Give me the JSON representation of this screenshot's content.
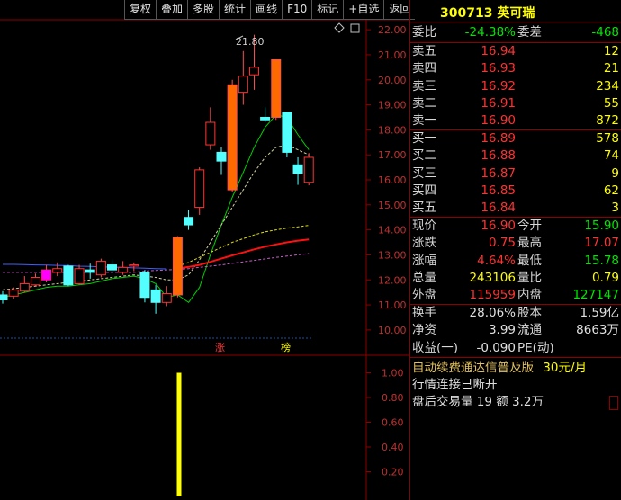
{
  "toolbar": [
    "复权",
    "叠加",
    "多股",
    "统计",
    "画线",
    "F10",
    "标记",
    "+自选",
    "返回"
  ],
  "stock": {
    "code": "300713",
    "name": "英可瑞"
  },
  "weibi": {
    "label1": "委比",
    "value1": "-24.38%",
    "label2": "委差",
    "value2": "-468"
  },
  "sell_orders": [
    {
      "label": "卖五",
      "price": "16.94",
      "volume": "12"
    },
    {
      "label": "卖四",
      "price": "16.93",
      "volume": "21"
    },
    {
      "label": "卖三",
      "price": "16.92",
      "volume": "234"
    },
    {
      "label": "卖二",
      "price": "16.91",
      "volume": "55"
    },
    {
      "label": "卖一",
      "price": "16.90",
      "volume": "872"
    }
  ],
  "buy_orders": [
    {
      "label": "买一",
      "price": "16.89",
      "volume": "578"
    },
    {
      "label": "买二",
      "price": "16.88",
      "volume": "74"
    },
    {
      "label": "买三",
      "price": "16.87",
      "volume": "9"
    },
    {
      "label": "买四",
      "price": "16.85",
      "volume": "62"
    },
    {
      "label": "买五",
      "price": "16.84",
      "volume": "3"
    }
  ],
  "stats_a": [
    {
      "l1": "现价",
      "v1": "16.90",
      "c1": "red",
      "l2": "今开",
      "v2": "15.90",
      "c2": "green"
    },
    {
      "l1": "涨跌",
      "v1": "0.75",
      "c1": "red",
      "l2": "最高",
      "v2": "17.07",
      "c2": "red"
    },
    {
      "l1": "涨幅",
      "v1": "4.64%",
      "c1": "red",
      "l2": "最低",
      "v2": "15.78",
      "c2": "green"
    },
    {
      "l1": "总量",
      "v1": "243106",
      "c1": "yellow",
      "l2": "量比",
      "v2": "0.79",
      "c2": "yellow"
    },
    {
      "l1": "外盘",
      "v1": "115959",
      "c1": "red",
      "l2": "内盘",
      "v2": "127147",
      "c2": "green"
    }
  ],
  "stats_b": [
    {
      "l1": "换手",
      "v1": "28.06%",
      "c1": "white",
      "l2": "股本",
      "v2": "1.59亿",
      "c2": "white"
    },
    {
      "l1": "净资",
      "v1": "3.99",
      "c1": "white",
      "l2": "流通",
      "v2": "8663万",
      "c2": "white"
    },
    {
      "l1": "收益(一)",
      "v1": "-0.090",
      "c1": "white",
      "l2": "PE(动)",
      "v2": "",
      "c2": "white"
    }
  ],
  "info": {
    "promo": "自动续费通达信普及版",
    "promo_price": "30元/月",
    "status": "行情连接已断开",
    "after_hours": "盘后交易量 19 额 3.2万"
  },
  "markers": [
    "涨",
    "榜"
  ],
  "high_label": "21.80",
  "chart_data": {
    "type": "candlestick",
    "price_axis": {
      "ticks": [
        10.0,
        11.0,
        12.0,
        13.0,
        14.0,
        15.0,
        16.0,
        17.0,
        18.0,
        19.0,
        20.0,
        21.0,
        22.0
      ],
      "range": [
        9.6,
        22.4
      ]
    },
    "volume_axis": {
      "ticks": [
        0.2,
        0.4,
        0.6,
        0.8,
        1.0
      ],
      "range": [
        0,
        1.12
      ]
    },
    "candles": [
      {
        "o": 11.4,
        "c": 11.2,
        "h": 11.55,
        "l": 11.05
      },
      {
        "o": 11.35,
        "c": 11.6,
        "h": 11.7,
        "l": 11.25
      },
      {
        "o": 11.55,
        "c": 11.85,
        "h": 12.15,
        "l": 11.5
      },
      {
        "o": 11.8,
        "c": 12.1,
        "h": 12.25,
        "l": 11.75
      },
      {
        "o": 12.0,
        "c": 12.4,
        "h": 12.6,
        "l": 11.9
      },
      {
        "o": 12.3,
        "c": 12.45,
        "h": 12.7,
        "l": 12.15
      },
      {
        "o": 12.55,
        "c": 11.8,
        "h": 12.6,
        "l": 11.75
      },
      {
        "o": 11.85,
        "c": 12.45,
        "h": 12.6,
        "l": 11.8
      },
      {
        "o": 12.4,
        "c": 12.3,
        "h": 12.65,
        "l": 12.05
      },
      {
        "o": 12.2,
        "c": 12.75,
        "h": 12.85,
        "l": 12.1
      },
      {
        "o": 12.6,
        "c": 12.4,
        "h": 12.8,
        "l": 12.3
      },
      {
        "o": 12.3,
        "c": 12.5,
        "h": 12.75,
        "l": 12.2
      },
      {
        "o": 12.55,
        "c": 12.6,
        "h": 12.7,
        "l": 12.35
      },
      {
        "o": 12.3,
        "c": 11.3,
        "h": 12.4,
        "l": 11.1
      },
      {
        "o": 11.6,
        "c": 11.1,
        "h": 11.8,
        "l": 10.65
      },
      {
        "o": 11.1,
        "c": 11.45,
        "h": 11.75,
        "l": 10.95
      },
      {
        "o": 11.4,
        "c": 13.7,
        "h": 13.75,
        "l": 11.3
      },
      {
        "o": 14.5,
        "c": 14.2,
        "h": 14.8,
        "l": 14.0
      },
      {
        "o": 14.9,
        "c": 16.4,
        "h": 16.5,
        "l": 14.6
      },
      {
        "o": 17.4,
        "c": 18.3,
        "h": 18.9,
        "l": 17.2
      },
      {
        "o": 17.1,
        "c": 16.75,
        "h": 17.3,
        "l": 16.2
      },
      {
        "o": 15.6,
        "c": 19.8,
        "h": 20.0,
        "l": 15.5
      },
      {
        "o": 19.5,
        "c": 20.15,
        "h": 21.15,
        "l": 19.0
      },
      {
        "o": 20.2,
        "c": 20.5,
        "h": 21.8,
        "l": 19.6
      },
      {
        "o": 18.5,
        "c": 18.4,
        "h": 18.9,
        "l": 18.3
      },
      {
        "o": 18.5,
        "c": 20.8,
        "h": 20.8,
        "l": 18.4
      },
      {
        "o": 18.7,
        "c": 17.1,
        "h": 18.7,
        "l": 16.9
      },
      {
        "o": 16.6,
        "c": 16.25,
        "h": 16.9,
        "l": 15.8
      },
      {
        "o": 15.9,
        "c": 16.9,
        "h": 17.07,
        "l": 15.78
      }
    ],
    "ma_lines": [
      {
        "color": "#00d000",
        "dash": false,
        "values": [
          11.3,
          11.4,
          11.5,
          11.6,
          11.7,
          11.75,
          11.75,
          11.8,
          11.85,
          11.95,
          12.05,
          12.1,
          12.15,
          12.05,
          11.85,
          11.3,
          11.4,
          11.1,
          11.7,
          13.0,
          14.2,
          15.3,
          16.3,
          17.3,
          18.1,
          18.6,
          18.5,
          17.8,
          17.2
        ]
      },
      {
        "color": "#d0d0a0",
        "dash": true,
        "values": [
          11.6,
          11.65,
          11.7,
          11.75,
          11.8,
          11.85,
          11.9,
          11.95,
          12.0,
          12.05,
          12.1,
          12.15,
          12.2,
          12.15,
          12.1,
          12.0,
          12.0,
          12.2,
          12.8,
          13.5,
          14.2,
          14.9,
          15.6,
          16.3,
          16.9,
          17.3,
          17.4,
          17.2,
          17.0
        ]
      },
      {
        "color": "#ff1010",
        "dash": false,
        "values": [
          null,
          null,
          null,
          null,
          null,
          null,
          null,
          null,
          null,
          null,
          null,
          null,
          null,
          null,
          null,
          null,
          12.45,
          12.52,
          12.6,
          12.72,
          12.85,
          12.98,
          13.1,
          13.22,
          13.33,
          13.42,
          13.5,
          13.57,
          13.62
        ]
      },
      {
        "color": "#e0e000",
        "dash": true,
        "values": [
          null,
          null,
          null,
          null,
          null,
          null,
          null,
          null,
          null,
          null,
          null,
          null,
          null,
          null,
          null,
          null,
          12.55,
          12.7,
          12.9,
          13.1,
          13.3,
          13.5,
          13.65,
          13.8,
          13.92,
          14.0,
          14.07,
          14.12,
          14.18
        ]
      },
      {
        "color": "#c060c0",
        "dash": true,
        "values": [
          12.3,
          12.3,
          12.3,
          12.3,
          12.3,
          12.3,
          12.3,
          12.3,
          12.3,
          12.3,
          12.3,
          12.3,
          12.3,
          12.35,
          12.38,
          12.4,
          12.42,
          12.45,
          12.5,
          12.55,
          12.6,
          12.66,
          12.72,
          12.78,
          12.84,
          12.9,
          12.95,
          13.0,
          13.05
        ]
      },
      {
        "color": "#4060ff",
        "dash": false,
        "values": [
          12.62,
          12.62,
          12.61,
          12.6,
          12.59,
          12.58,
          12.57,
          12.55,
          12.54,
          12.52,
          12.51,
          12.5,
          12.48,
          12.47,
          12.45,
          12.44,
          null,
          null,
          null,
          null,
          null,
          null,
          null,
          null,
          null,
          null,
          null,
          null,
          null
        ]
      }
    ],
    "volume_bars": [
      {
        "index": 14,
        "value": 1.0
      }
    ]
  }
}
